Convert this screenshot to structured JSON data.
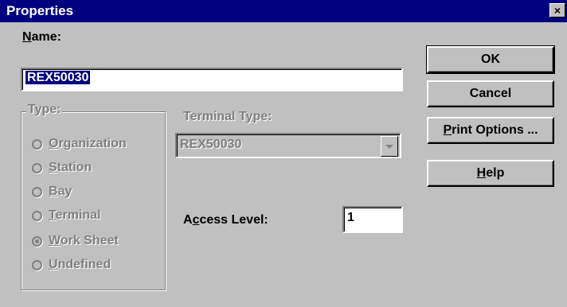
{
  "window": {
    "title": "Properties",
    "close_label": "×"
  },
  "name": {
    "label_underlined": "N",
    "label_rest": "ame:",
    "value": "REX50030"
  },
  "type_group": {
    "legend": "Type:",
    "options": [
      {
        "u": "O",
        "rest": "rganization",
        "checked": false
      },
      {
        "u": "S",
        "rest": "tation",
        "checked": false
      },
      {
        "u": "B",
        "rest": "ay",
        "checked": false
      },
      {
        "u": "T",
        "rest": "erminal",
        "checked": false
      },
      {
        "u": "W",
        "rest": "ork Sheet",
        "checked": true
      },
      {
        "u": "U",
        "rest": "ndefined",
        "checked": false
      }
    ]
  },
  "terminal_type": {
    "label_pre": "Terminal T",
    "label_u": "y",
    "label_post": "pe:",
    "value": "REX50030"
  },
  "access_level": {
    "label_pre": "A",
    "label_u": "c",
    "label_post": "cess Level:",
    "value": "1"
  },
  "buttons": {
    "ok": "OK",
    "cancel": "Cancel",
    "print_u": "P",
    "print_rest": "rint Options ...",
    "help_u": "H",
    "help_rest": "elp"
  },
  "icons": {
    "close": "close-icon",
    "combo": "chevron-down-icon",
    "radio": "radio-icon"
  }
}
